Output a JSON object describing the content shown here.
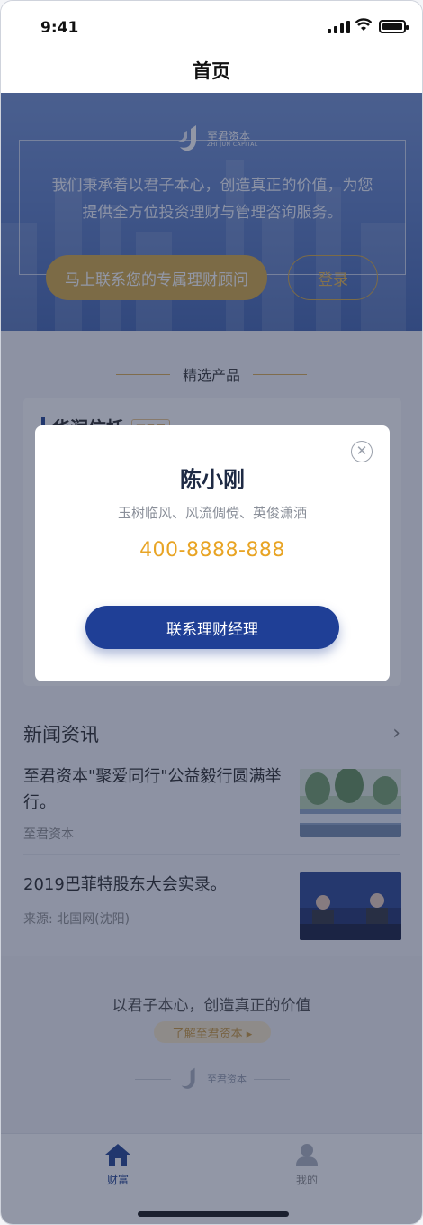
{
  "status_bar": {
    "time": "9:41"
  },
  "nav": {
    "title": "首页"
  },
  "hero": {
    "logo_text": "至君资本",
    "logo_sub": "ZHI JUN CAPITAL",
    "slogan_line1": "我们秉承着以君子本心，创造真正的价值，为您",
    "slogan_line2": "提供全方位投资理财与管理咨询服务。",
    "contact_button": "马上联系您的专属理财顾问",
    "login_button": "登录"
  },
  "products": {
    "section_title": "精选产品",
    "card_name": "华润信托",
    "card_tag": "至君严"
  },
  "news": {
    "section_title": "新闻资讯",
    "items": [
      {
        "headline": "至君资本\"聚爱同行\"公益毅行圆满举行。",
        "source": "至君资本"
      },
      {
        "headline": "2019巴菲特股东大会实录。",
        "source": "来源: 北国网(沈阳)"
      }
    ]
  },
  "footer": {
    "motto": "以君子本心，创造真正的价值",
    "learn_more": "了解至君资本 ▸",
    "logo_text": "至君资本"
  },
  "tabs": [
    {
      "label": "财富",
      "active": true
    },
    {
      "label": "我的",
      "active": false
    }
  ],
  "modal": {
    "name": "陈小刚",
    "description": "玉树临风、风流倜傥、英俊潇洒",
    "phone": "400-8888-888",
    "action_button": "联系理财经理",
    "close_symbol": "✕"
  },
  "colors": {
    "brand_blue": "#1f3f96",
    "gold": "#d2a63f",
    "phone_orange": "#e8a424"
  }
}
